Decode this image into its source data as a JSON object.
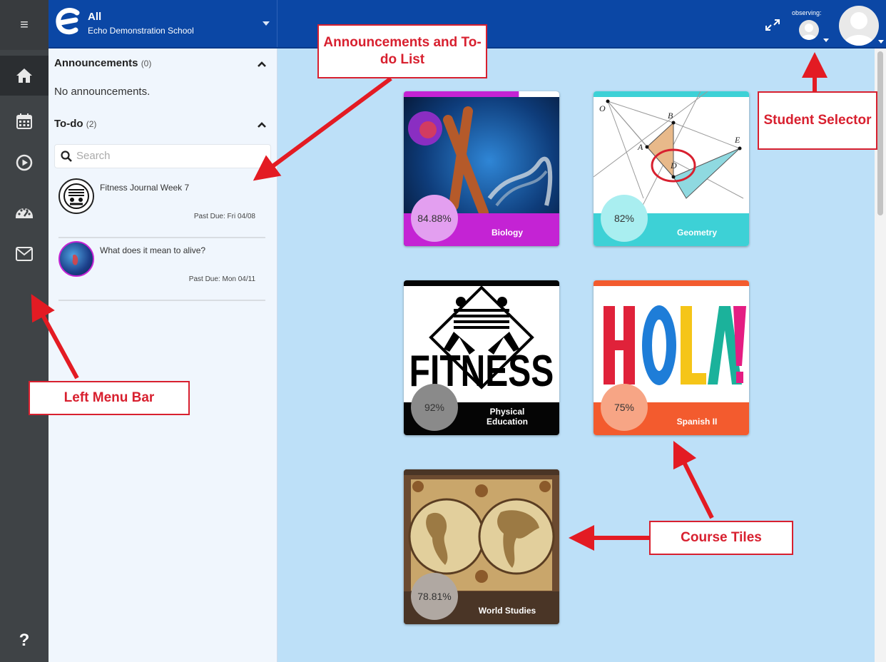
{
  "header": {
    "title": "All",
    "school": "Echo Demonstration School",
    "observing_label": "observing:"
  },
  "sidebar": {
    "items": [
      {
        "icon": "home-icon",
        "label": "Home"
      },
      {
        "icon": "calendar-icon",
        "label": "Calendar"
      },
      {
        "icon": "play-icon",
        "label": "Activity"
      },
      {
        "icon": "dashboard-icon",
        "label": "Progress"
      },
      {
        "icon": "mail-icon",
        "label": "Messages"
      }
    ],
    "help_label": "?"
  },
  "announcements": {
    "heading": "Announcements",
    "count": "(0)",
    "empty_text": "No announcements."
  },
  "todo": {
    "heading": "To-do",
    "count": "(2)",
    "search_placeholder": "Search",
    "items": [
      {
        "title": "Fitness Journal Week 7",
        "due": "Past Due: Fri 04/08"
      },
      {
        "title": "What does it mean to alive?",
        "due": "Past Due: Mon 04/11"
      }
    ]
  },
  "courses": [
    {
      "name": "Biology",
      "percent": "84.88%",
      "accent": "#c423d4",
      "pct_color": "#e39ff0",
      "progress": 0.74
    },
    {
      "name": "Geometry",
      "percent": "82%",
      "accent": "#3dd1d6",
      "pct_color": "#a9eef0",
      "progress": 1.0
    },
    {
      "name": "Physical Education",
      "percent": "92%",
      "accent": "#050505",
      "pct_color": "#8a8a8a",
      "progress": 1.0
    },
    {
      "name": "Spanish II",
      "percent": "75%",
      "accent": "#f35b2e",
      "pct_color": "#f7a585",
      "progress": 1.0
    },
    {
      "name": "World Studies",
      "percent": "78.81%",
      "accent": "#4a3526",
      "pct_color": "#b0a8a2",
      "progress": 1.0
    }
  ],
  "annotations": {
    "announcements_todo": "Announcements and To-do List",
    "student_selector": "Student Selector",
    "left_menu": "Left Menu Bar",
    "course_tiles": "Course Tiles"
  },
  "colors": {
    "header_blue": "#0b47a5",
    "main_bg": "#bde0f8",
    "sidebar_dark": "#3f4346",
    "annotation_red": "#d8202f"
  }
}
